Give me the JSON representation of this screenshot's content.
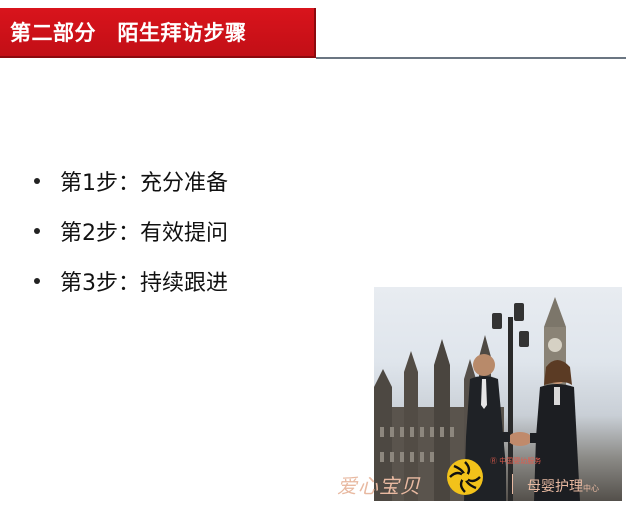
{
  "header": {
    "title": "第二部分　陌生拜访步骤"
  },
  "steps": [
    {
      "label": "第1步：充分准备"
    },
    {
      "label": "第2步：有效提问"
    },
    {
      "label": "第3步：持续跟进"
    }
  ],
  "logo": {
    "brand_left": "爱心宝贝",
    "brand_right": "母婴护理",
    "brand_right_suffix": "中心",
    "small_caption": "Ⓡ 中国婴幼服务"
  },
  "colors": {
    "header_red": "#d9141c",
    "rule_gray": "#6b7682",
    "logo_orange": "#e8b9a1"
  },
  "icons": {
    "bullet": "bullet-dot-icon",
    "logo_sun": "sun-logo-icon"
  }
}
